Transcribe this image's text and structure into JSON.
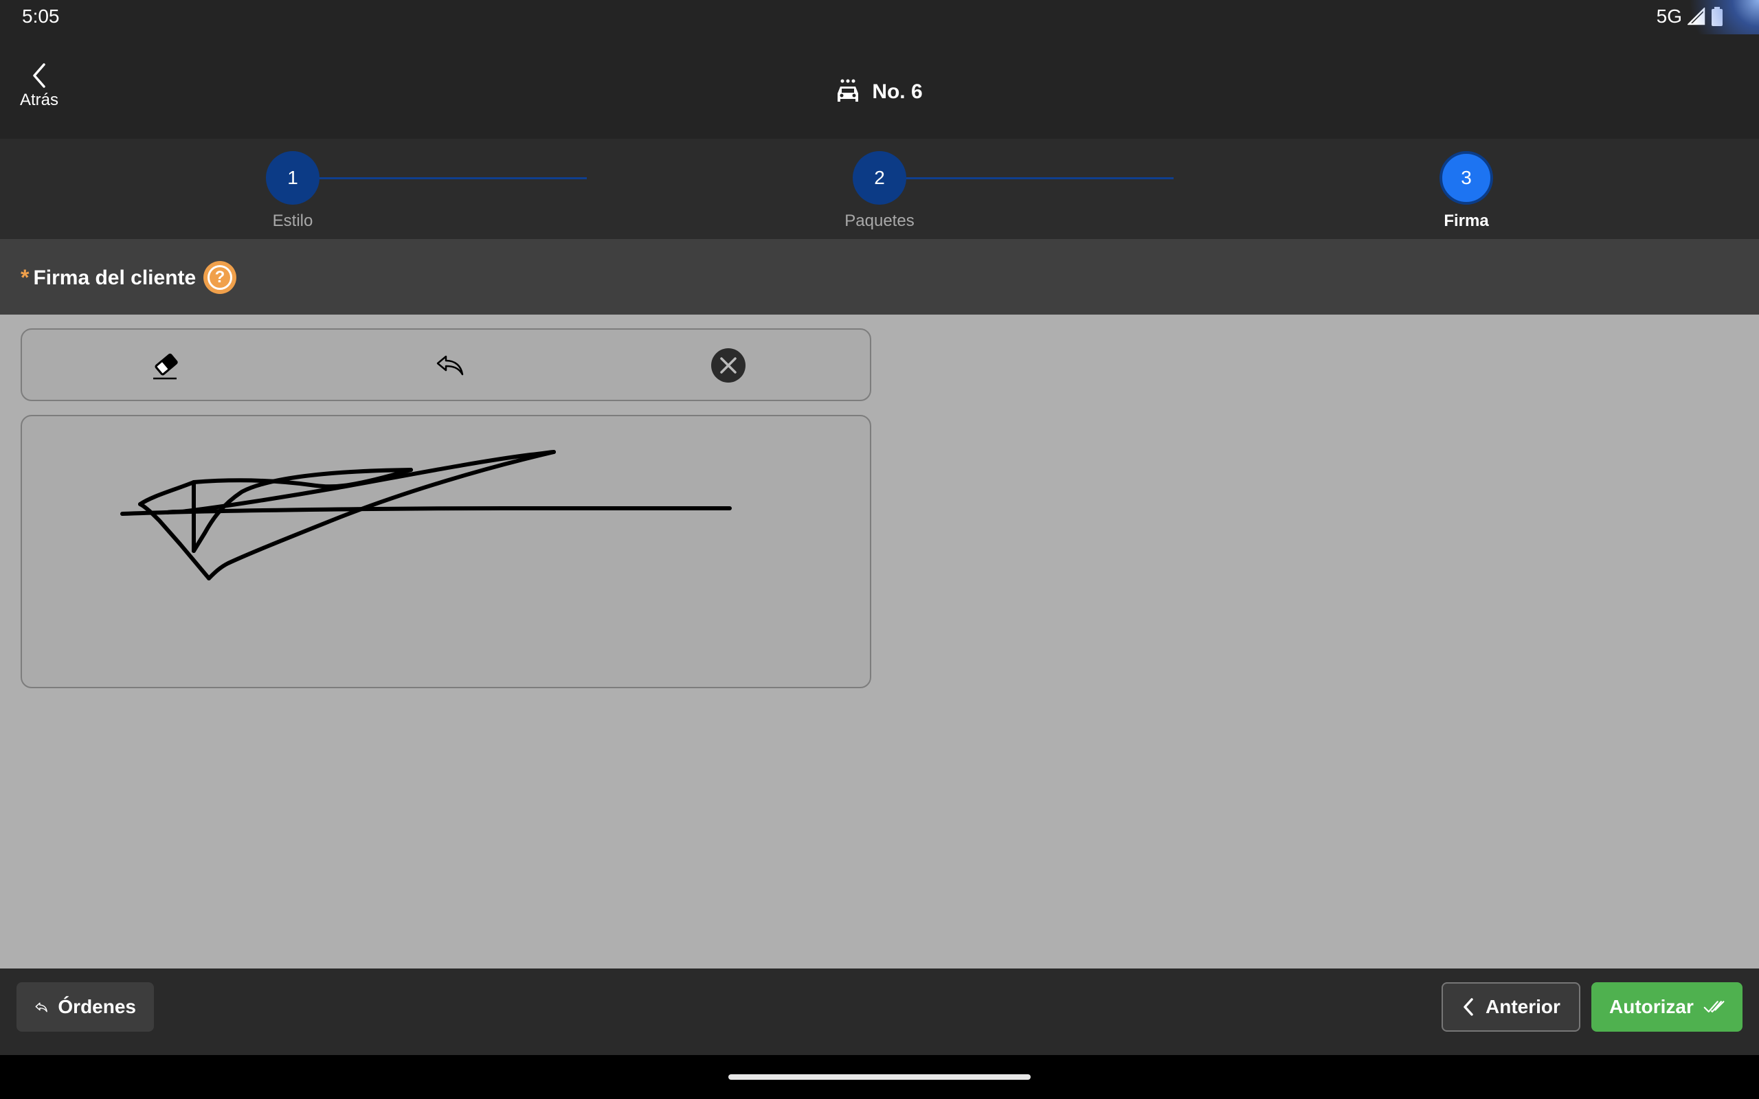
{
  "status_bar": {
    "time": "5:05",
    "network": "5G"
  },
  "header": {
    "back_label": "Atrás",
    "title": "No. 6"
  },
  "stepper": {
    "steps": [
      {
        "number": "1",
        "label": "Estilo"
      },
      {
        "number": "2",
        "label": "Paquetes"
      },
      {
        "number": "3",
        "label": "Firma"
      }
    ],
    "active_step": 3
  },
  "section": {
    "required_mark": "*",
    "title": "Firma del cliente",
    "help_glyph": "?"
  },
  "toolbar": {
    "tools": [
      "eraser-icon",
      "undo-icon",
      "clear-icon"
    ]
  },
  "footer": {
    "orders_label": "Órdenes",
    "previous_label": "Anterior",
    "authorize_label": "Autorizar"
  },
  "colors": {
    "accent": "#1d74f2",
    "step_done": "#0c3b86",
    "required": "#f0a04b",
    "authorize": "#4fb14f",
    "content_bg": "#afafaf"
  }
}
